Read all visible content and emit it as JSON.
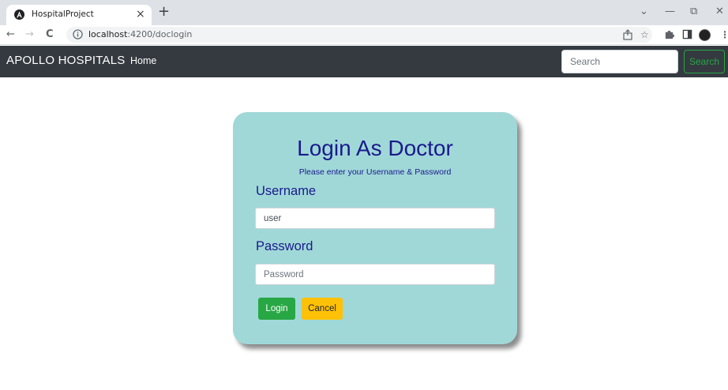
{
  "browser": {
    "tab_title": "HospitalProject",
    "tab_close": "×",
    "new_tab": "+",
    "url_host": "localhost",
    "url_path": ":4200/doclogin",
    "win_minimize": "—",
    "win_restore": "⧉",
    "win_close": "✕",
    "tab_dropdown": "⌄",
    "back": "←",
    "forward": "→",
    "reload": "C"
  },
  "navbar": {
    "brand": "APOLLO HOSPITALS",
    "home": "Home",
    "search_placeholder": "Search",
    "search_button": "Search"
  },
  "login": {
    "title": "Login As Doctor",
    "subtitle": "Please enter your Username & Password",
    "username_label": "Username",
    "username_value": "user",
    "password_label": "Password",
    "password_placeholder": "Password",
    "login_button": "Login",
    "cancel_button": "Cancel"
  },
  "colors": {
    "navbar_bg": "#343a40",
    "card_bg": "#a0d8d8",
    "heading": "#1a1a8c",
    "login_btn": "#28a745",
    "cancel_btn": "#ffc107"
  }
}
